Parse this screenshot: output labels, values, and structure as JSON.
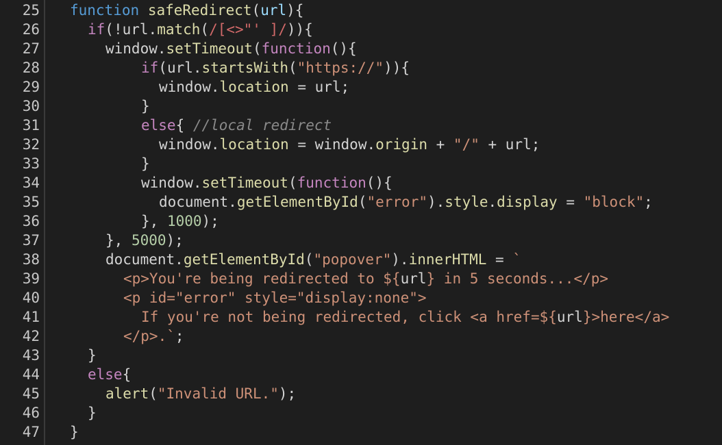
{
  "colors": {
    "background": "#1e1e1e",
    "keyword": "#c586c0",
    "function_name": "#dcdcaa",
    "plain": "#d4d4d4",
    "property": "#9cdcfe",
    "string": "#ce9178",
    "number": "#b5cea8",
    "comment": "#8a8a8a"
  },
  "editor": {
    "lines": [
      {
        "number": "25",
        "indent": 1,
        "tokens": [
          {
            "t": "function",
            "c": "#569cd6"
          },
          {
            "t": " ",
            "c": "#d4d4d4"
          },
          {
            "t": "safeRedirect",
            "c": "#dcdcaa"
          },
          {
            "t": "(",
            "c": "#d4d4d4"
          },
          {
            "t": "url",
            "c": "#9cdcfe"
          },
          {
            "t": "){",
            "c": "#d4d4d4"
          }
        ]
      },
      {
        "number": "26",
        "indent": 2,
        "tokens": [
          {
            "t": "if",
            "c": "#c586c0"
          },
          {
            "t": "(!",
            "c": "#d4d4d4"
          },
          {
            "t": "url",
            "c": "#d4d4d4"
          },
          {
            "t": ".",
            "c": "#d4d4d4"
          },
          {
            "t": "match",
            "c": "#dcdcaa"
          },
          {
            "t": "(",
            "c": "#d4d4d4"
          },
          {
            "t": "/[<>\"' ]/",
            "c": "#d16969"
          },
          {
            "t": ")){",
            "c": "#d4d4d4"
          }
        ]
      },
      {
        "number": "27",
        "indent": 3,
        "tokens": [
          {
            "t": "window",
            "c": "#d4d4d4"
          },
          {
            "t": ".",
            "c": "#d4d4d4"
          },
          {
            "t": "setTimeout",
            "c": "#dcdcaa"
          },
          {
            "t": "(",
            "c": "#d4d4d4"
          },
          {
            "t": "function",
            "c": "#c586c0"
          },
          {
            "t": "(){",
            "c": "#d4d4d4"
          }
        ]
      },
      {
        "number": "28",
        "indent": 5,
        "tokens": [
          {
            "t": "if",
            "c": "#c586c0"
          },
          {
            "t": "(",
            "c": "#d4d4d4"
          },
          {
            "t": "url",
            "c": "#d4d4d4"
          },
          {
            "t": ".",
            "c": "#d4d4d4"
          },
          {
            "t": "startsWith",
            "c": "#dcdcaa"
          },
          {
            "t": "(",
            "c": "#d4d4d4"
          },
          {
            "t": "\"https://\"",
            "c": "#ce9178"
          },
          {
            "t": ")){",
            "c": "#d4d4d4"
          }
        ]
      },
      {
        "number": "29",
        "indent": 6,
        "tokens": [
          {
            "t": "window",
            "c": "#d4d4d4"
          },
          {
            "t": ".",
            "c": "#d4d4d4"
          },
          {
            "t": "location",
            "c": "#dcdcaa"
          },
          {
            "t": " = ",
            "c": "#d4d4d4"
          },
          {
            "t": "url",
            "c": "#d4d4d4"
          },
          {
            "t": ";",
            "c": "#d4d4d4"
          }
        ]
      },
      {
        "number": "30",
        "indent": 5,
        "tokens": [
          {
            "t": "}",
            "c": "#d4d4d4"
          }
        ]
      },
      {
        "number": "31",
        "indent": 5,
        "tokens": [
          {
            "t": "else",
            "c": "#c586c0"
          },
          {
            "t": "{ ",
            "c": "#d4d4d4"
          },
          {
            "t": "//local redirect",
            "c": "#8a8a8a",
            "italic": true
          }
        ]
      },
      {
        "number": "32",
        "indent": 6,
        "tokens": [
          {
            "t": "window",
            "c": "#d4d4d4"
          },
          {
            "t": ".",
            "c": "#d4d4d4"
          },
          {
            "t": "location",
            "c": "#dcdcaa"
          },
          {
            "t": " = ",
            "c": "#d4d4d4"
          },
          {
            "t": "window",
            "c": "#d4d4d4"
          },
          {
            "t": ".",
            "c": "#d4d4d4"
          },
          {
            "t": "origin",
            "c": "#dcdcaa"
          },
          {
            "t": " + ",
            "c": "#d4d4d4"
          },
          {
            "t": "\"/\"",
            "c": "#ce9178"
          },
          {
            "t": " + ",
            "c": "#d4d4d4"
          },
          {
            "t": "url",
            "c": "#d4d4d4"
          },
          {
            "t": ";",
            "c": "#d4d4d4"
          }
        ]
      },
      {
        "number": "33",
        "indent": 5,
        "tokens": [
          {
            "t": "}",
            "c": "#d4d4d4"
          }
        ]
      },
      {
        "number": "34",
        "indent": 5,
        "tokens": [
          {
            "t": "window",
            "c": "#d4d4d4"
          },
          {
            "t": ".",
            "c": "#d4d4d4"
          },
          {
            "t": "setTimeout",
            "c": "#dcdcaa"
          },
          {
            "t": "(",
            "c": "#d4d4d4"
          },
          {
            "t": "function",
            "c": "#c586c0"
          },
          {
            "t": "(){",
            "c": "#d4d4d4"
          }
        ]
      },
      {
        "number": "35",
        "indent": 6,
        "tokens": [
          {
            "t": "document",
            "c": "#d4d4d4"
          },
          {
            "t": ".",
            "c": "#d4d4d4"
          },
          {
            "t": "getElementById",
            "c": "#dcdcaa"
          },
          {
            "t": "(",
            "c": "#d4d4d4"
          },
          {
            "t": "\"error\"",
            "c": "#ce9178"
          },
          {
            "t": ").",
            "c": "#d4d4d4"
          },
          {
            "t": "style",
            "c": "#dcdcaa"
          },
          {
            "t": ".",
            "c": "#d4d4d4"
          },
          {
            "t": "display",
            "c": "#dcdcaa"
          },
          {
            "t": " = ",
            "c": "#d4d4d4"
          },
          {
            "t": "\"block\"",
            "c": "#ce9178"
          },
          {
            "t": ";",
            "c": "#d4d4d4"
          }
        ]
      },
      {
        "number": "36",
        "indent": 5,
        "tokens": [
          {
            "t": "}, ",
            "c": "#d4d4d4"
          },
          {
            "t": "1000",
            "c": "#b5cea8"
          },
          {
            "t": ");",
            "c": "#d4d4d4"
          }
        ]
      },
      {
        "number": "37",
        "indent": 3,
        "tokens": [
          {
            "t": "}, ",
            "c": "#d4d4d4"
          },
          {
            "t": "5000",
            "c": "#b5cea8"
          },
          {
            "t": ");",
            "c": "#d4d4d4"
          }
        ]
      },
      {
        "number": "38",
        "indent": 3,
        "tokens": [
          {
            "t": "document",
            "c": "#d4d4d4"
          },
          {
            "t": ".",
            "c": "#d4d4d4"
          },
          {
            "t": "getElementById",
            "c": "#dcdcaa"
          },
          {
            "t": "(",
            "c": "#d4d4d4"
          },
          {
            "t": "\"popover\"",
            "c": "#ce9178"
          },
          {
            "t": ").",
            "c": "#d4d4d4"
          },
          {
            "t": "innerHTML",
            "c": "#dcdcaa"
          },
          {
            "t": " = ",
            "c": "#d4d4d4"
          },
          {
            "t": "`",
            "c": "#ce9178"
          }
        ]
      },
      {
        "number": "39",
        "indent": 4,
        "tokens": [
          {
            "t": "<p>You're being redirected to ${",
            "c": "#ce9178"
          },
          {
            "t": "url",
            "c": "#d4d4d4"
          },
          {
            "t": "} in 5 seconds...</p>",
            "c": "#ce9178"
          }
        ]
      },
      {
        "number": "40",
        "indent": 4,
        "tokens": [
          {
            "t": "<p id=\"error\" style=\"display:none\">",
            "c": "#ce9178"
          }
        ]
      },
      {
        "number": "41",
        "indent": 5,
        "tokens": [
          {
            "t": "If you're not being redirected, click <a href=${",
            "c": "#ce9178"
          },
          {
            "t": "url",
            "c": "#d4d4d4"
          },
          {
            "t": "}>here</a>",
            "c": "#ce9178"
          }
        ]
      },
      {
        "number": "42",
        "indent": 4,
        "tokens": [
          {
            "t": "</p>.`",
            "c": "#ce9178"
          },
          {
            "t": ";",
            "c": "#d4d4d4"
          }
        ]
      },
      {
        "number": "43",
        "indent": 2,
        "tokens": [
          {
            "t": "}",
            "c": "#d4d4d4"
          }
        ]
      },
      {
        "number": "44",
        "indent": 2,
        "tokens": [
          {
            "t": "else",
            "c": "#c586c0"
          },
          {
            "t": "{",
            "c": "#d4d4d4"
          }
        ]
      },
      {
        "number": "45",
        "indent": 3,
        "tokens": [
          {
            "t": "alert",
            "c": "#dcdcaa"
          },
          {
            "t": "(",
            "c": "#d4d4d4"
          },
          {
            "t": "\"Invalid URL.\"",
            "c": "#ce9178"
          },
          {
            "t": ");",
            "c": "#d4d4d4"
          }
        ]
      },
      {
        "number": "46",
        "indent": 2,
        "tokens": [
          {
            "t": "}",
            "c": "#d4d4d4"
          }
        ]
      },
      {
        "number": "47",
        "indent": 1,
        "tokens": [
          {
            "t": "}",
            "c": "#d4d4d4"
          }
        ]
      }
    ]
  }
}
